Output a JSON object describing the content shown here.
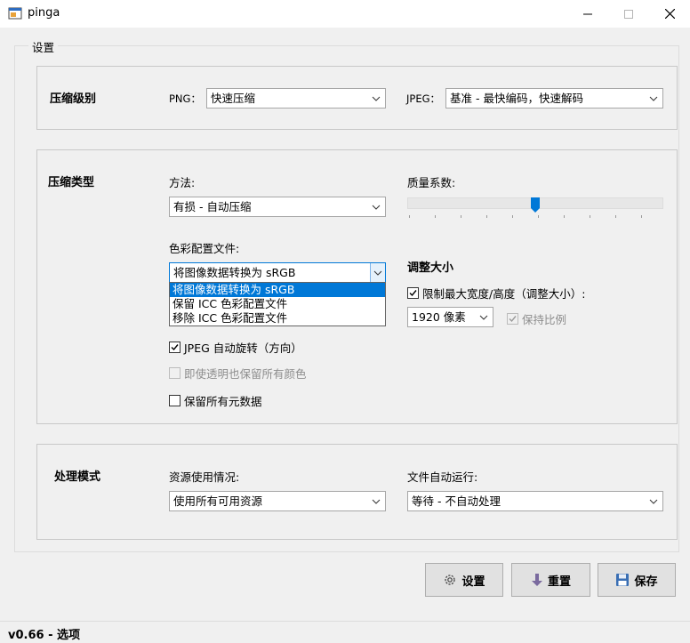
{
  "window": {
    "title": "pinga",
    "minimize_icon": "minimize-icon",
    "maximize_icon": "maximize-icon",
    "close_icon": "close-icon"
  },
  "settings_group": {
    "legend": "设置"
  },
  "compression_level": {
    "title": "压缩级别",
    "png_label": "PNG：",
    "png_value": "快速压缩",
    "jpeg_label": "JPEG：",
    "jpeg_value": "基准 - 最快编码，快速解码"
  },
  "compression_type": {
    "title": "压缩类型",
    "method_label": "方法:",
    "method_value": "有损 - 自动压缩",
    "quality_label": "质量系数:",
    "quality_level": 0.5,
    "color_profile_label": "色彩配置文件:",
    "color_profile_value": "将图像数据转换为 sRGB",
    "color_profile_options": [
      "将图像数据转换为 sRGB",
      "保留 ICC 色彩配置文件",
      "移除 ICC 色彩配置文件"
    ],
    "jpeg_autorotate_label": "JPEG 自动旋转（方向）",
    "jpeg_autorotate_checked": true,
    "keep_colors_label": "即使透明也保留所有颜色",
    "keep_colors_checked": false,
    "keep_colors_enabled": false,
    "keep_metadata_label": "保留所有元数据",
    "keep_metadata_checked": false
  },
  "resize": {
    "title": "调整大小",
    "limit_label": "限制最大宽度/高度（调整大小）:",
    "limit_checked": true,
    "size_value": "1920 像素",
    "keep_ratio_label": "保持比例",
    "keep_ratio_checked": true,
    "keep_ratio_enabled": false
  },
  "processing_mode": {
    "title": "处理模式",
    "resources_label": "资源使用情况:",
    "resources_value": "使用所有可用资源",
    "autorun_label": "文件自动运行:",
    "autorun_value": "等待 - 不自动处理"
  },
  "buttons": {
    "settings": "设置",
    "settings_icon": "gear-icon",
    "reset": "重置",
    "reset_icon": "arrow-down-icon",
    "save": "保存",
    "save_icon": "floppy-disk-icon"
  },
  "status": {
    "text": "v0.66 - 选项"
  },
  "colors": {
    "accent": "#0078d7",
    "window_bg": "#f0f0f0",
    "reset_icon": "#7a6a9e",
    "save_icon": "#3a6fb4"
  }
}
